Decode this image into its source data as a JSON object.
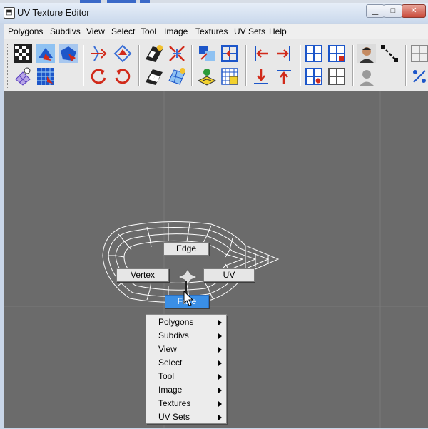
{
  "window": {
    "title": "UV Texture Editor"
  },
  "caption_buttons": {
    "minimize": "▁",
    "maximize": "□",
    "close": "✕"
  },
  "menubar": [
    "Polygons",
    "Subdivs",
    "View",
    "Select",
    "Tool",
    "Image",
    "Textures",
    "UV Sets",
    "Help"
  ],
  "toolbar": {
    "icons": [
      "checker-display-icon",
      "move-uv-shell-icon",
      "flip-uvs-icon",
      "rotate-uvs-icon",
      "map-uv-border-icon",
      "cut-uv-icon",
      "sew-uv-icon",
      "layout-uvs-icon",
      "move-left-icon",
      "move-right-icon",
      "grid-display-icon",
      "grid-add-icon",
      "user-avatar-icon",
      "diagonal-select-icon",
      "more-icon",
      "uv-mesh-icon",
      "pattern-grid-icon",
      "rotate-ccw-icon",
      "rotate-cw-icon",
      "checker-alt-icon",
      "uv-lattice-icon",
      "uv-snapshot-icon",
      "grid-select-icon",
      "move-down-icon",
      "move-up-icon",
      "grid-dot-icon",
      "grid-remove-icon",
      "user-avatar-gray-icon",
      "scale-icon"
    ]
  },
  "marking_menu": {
    "north": "Edge",
    "west": "Vertex",
    "east": "UV",
    "south": "Face"
  },
  "context_menu": {
    "items": [
      "Polygons",
      "Subdivs",
      "View",
      "Select",
      "Tool",
      "Image",
      "Textures",
      "UV Sets"
    ]
  },
  "colors": {
    "canvas": "#6b6b6b",
    "wireframe": "#ffffff",
    "selection": "#3a8fe6"
  }
}
